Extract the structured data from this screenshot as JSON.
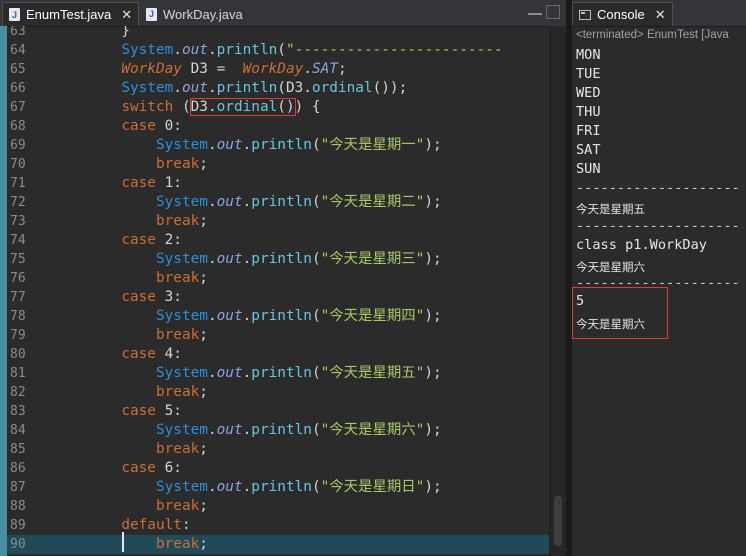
{
  "editor": {
    "tabs": [
      {
        "label": "EnumTest.java",
        "active": true
      },
      {
        "label": "WorkDay.java",
        "active": false
      }
    ],
    "lines": [
      {
        "num": "63",
        "segments": [
          {
            "t": "        }",
            "c": "plain"
          }
        ]
      },
      {
        "num": "64",
        "segments": [
          {
            "t": "        ",
            "c": "plain"
          },
          {
            "t": "System",
            "c": "cls"
          },
          {
            "t": ".",
            "c": "plain"
          },
          {
            "t": "out",
            "c": "fld"
          },
          {
            "t": ".",
            "c": "plain"
          },
          {
            "t": "println",
            "c": "mth"
          },
          {
            "t": "(",
            "c": "plain"
          },
          {
            "t": "\"------------------------",
            "c": "str"
          }
        ]
      },
      {
        "num": "65",
        "segments": [
          {
            "t": "        ",
            "c": "plain"
          },
          {
            "t": "WorkDay",
            "c": "kw ital"
          },
          {
            "t": " D3 =  ",
            "c": "plain"
          },
          {
            "t": "WorkDay",
            "c": "kw ital"
          },
          {
            "t": ".",
            "c": "plain"
          },
          {
            "t": "SAT",
            "c": "fld"
          },
          {
            "t": ";",
            "c": "plain"
          }
        ]
      },
      {
        "num": "66",
        "segments": [
          {
            "t": "        ",
            "c": "plain"
          },
          {
            "t": "System",
            "c": "cls"
          },
          {
            "t": ".",
            "c": "plain"
          },
          {
            "t": "out",
            "c": "fld"
          },
          {
            "t": ".",
            "c": "plain"
          },
          {
            "t": "println",
            "c": "mth"
          },
          {
            "t": "(D3.",
            "c": "plain"
          },
          {
            "t": "ordinal",
            "c": "mth"
          },
          {
            "t": "());",
            "c": "plain"
          }
        ]
      },
      {
        "num": "67",
        "segments": [
          {
            "t": "        ",
            "c": "plain"
          },
          {
            "t": "switch",
            "c": "kw"
          },
          {
            "t": " (",
            "c": "plain"
          },
          {
            "t": "D3.",
            "c": "plain",
            "box": "start"
          },
          {
            "t": "ordinal",
            "c": "mth"
          },
          {
            "t": "()",
            "c": "plain",
            "box": "end"
          },
          {
            "t": ") {",
            "c": "plain"
          }
        ]
      },
      {
        "num": "68",
        "segments": [
          {
            "t": "        ",
            "c": "plain"
          },
          {
            "t": "case",
            "c": "kw"
          },
          {
            "t": " 0:",
            "c": "plain"
          }
        ]
      },
      {
        "num": "69",
        "segments": [
          {
            "t": "            ",
            "c": "plain"
          },
          {
            "t": "System",
            "c": "cls"
          },
          {
            "t": ".",
            "c": "plain"
          },
          {
            "t": "out",
            "c": "fld"
          },
          {
            "t": ".",
            "c": "plain"
          },
          {
            "t": "println",
            "c": "mth"
          },
          {
            "t": "(",
            "c": "plain"
          },
          {
            "t": "\"今天是星期一\"",
            "c": "str"
          },
          {
            "t": ");",
            "c": "plain"
          }
        ]
      },
      {
        "num": "70",
        "segments": [
          {
            "t": "            ",
            "c": "plain"
          },
          {
            "t": "break",
            "c": "kw"
          },
          {
            "t": ";",
            "c": "plain"
          }
        ]
      },
      {
        "num": "71",
        "segments": [
          {
            "t": "        ",
            "c": "plain"
          },
          {
            "t": "case",
            "c": "kw"
          },
          {
            "t": " 1:",
            "c": "plain"
          }
        ]
      },
      {
        "num": "72",
        "segments": [
          {
            "t": "            ",
            "c": "plain"
          },
          {
            "t": "System",
            "c": "cls"
          },
          {
            "t": ".",
            "c": "plain"
          },
          {
            "t": "out",
            "c": "fld"
          },
          {
            "t": ".",
            "c": "plain"
          },
          {
            "t": "println",
            "c": "mth"
          },
          {
            "t": "(",
            "c": "plain"
          },
          {
            "t": "\"今天是星期二\"",
            "c": "str"
          },
          {
            "t": ");",
            "c": "plain"
          }
        ]
      },
      {
        "num": "73",
        "segments": [
          {
            "t": "            ",
            "c": "plain"
          },
          {
            "t": "break",
            "c": "kw"
          },
          {
            "t": ";",
            "c": "plain"
          }
        ]
      },
      {
        "num": "74",
        "segments": [
          {
            "t": "        ",
            "c": "plain"
          },
          {
            "t": "case",
            "c": "kw"
          },
          {
            "t": " 2:",
            "c": "plain"
          }
        ]
      },
      {
        "num": "75",
        "segments": [
          {
            "t": "            ",
            "c": "plain"
          },
          {
            "t": "System",
            "c": "cls"
          },
          {
            "t": ".",
            "c": "plain"
          },
          {
            "t": "out",
            "c": "fld"
          },
          {
            "t": ".",
            "c": "plain"
          },
          {
            "t": "println",
            "c": "mth"
          },
          {
            "t": "(",
            "c": "plain"
          },
          {
            "t": "\"今天是星期三\"",
            "c": "str"
          },
          {
            "t": ");",
            "c": "plain"
          }
        ]
      },
      {
        "num": "76",
        "segments": [
          {
            "t": "            ",
            "c": "plain"
          },
          {
            "t": "break",
            "c": "kw"
          },
          {
            "t": ";",
            "c": "plain"
          }
        ]
      },
      {
        "num": "77",
        "segments": [
          {
            "t": "        ",
            "c": "plain"
          },
          {
            "t": "case",
            "c": "kw"
          },
          {
            "t": " 3:",
            "c": "plain"
          }
        ]
      },
      {
        "num": "78",
        "segments": [
          {
            "t": "            ",
            "c": "plain"
          },
          {
            "t": "System",
            "c": "cls"
          },
          {
            "t": ".",
            "c": "plain"
          },
          {
            "t": "out",
            "c": "fld"
          },
          {
            "t": ".",
            "c": "plain"
          },
          {
            "t": "println",
            "c": "mth"
          },
          {
            "t": "(",
            "c": "plain"
          },
          {
            "t": "\"今天是星期四\"",
            "c": "str"
          },
          {
            "t": ");",
            "c": "plain"
          }
        ]
      },
      {
        "num": "79",
        "segments": [
          {
            "t": "            ",
            "c": "plain"
          },
          {
            "t": "break",
            "c": "kw"
          },
          {
            "t": ";",
            "c": "plain"
          }
        ]
      },
      {
        "num": "80",
        "segments": [
          {
            "t": "        ",
            "c": "plain"
          },
          {
            "t": "case",
            "c": "kw"
          },
          {
            "t": " 4:",
            "c": "plain"
          }
        ]
      },
      {
        "num": "81",
        "segments": [
          {
            "t": "            ",
            "c": "plain"
          },
          {
            "t": "System",
            "c": "cls"
          },
          {
            "t": ".",
            "c": "plain"
          },
          {
            "t": "out",
            "c": "fld"
          },
          {
            "t": ".",
            "c": "plain"
          },
          {
            "t": "println",
            "c": "mth"
          },
          {
            "t": "(",
            "c": "plain"
          },
          {
            "t": "\"今天是星期五\"",
            "c": "str"
          },
          {
            "t": ");",
            "c": "plain"
          }
        ]
      },
      {
        "num": "82",
        "segments": [
          {
            "t": "            ",
            "c": "plain"
          },
          {
            "t": "break",
            "c": "kw"
          },
          {
            "t": ";",
            "c": "plain"
          }
        ]
      },
      {
        "num": "83",
        "segments": [
          {
            "t": "        ",
            "c": "plain"
          },
          {
            "t": "case",
            "c": "kw"
          },
          {
            "t": " 5:",
            "c": "plain"
          }
        ]
      },
      {
        "num": "84",
        "segments": [
          {
            "t": "            ",
            "c": "plain"
          },
          {
            "t": "System",
            "c": "cls"
          },
          {
            "t": ".",
            "c": "plain"
          },
          {
            "t": "out",
            "c": "fld"
          },
          {
            "t": ".",
            "c": "plain"
          },
          {
            "t": "println",
            "c": "mth"
          },
          {
            "t": "(",
            "c": "plain"
          },
          {
            "t": "\"今天是星期六\"",
            "c": "str"
          },
          {
            "t": ");",
            "c": "plain"
          }
        ]
      },
      {
        "num": "85",
        "segments": [
          {
            "t": "            ",
            "c": "plain"
          },
          {
            "t": "break",
            "c": "kw"
          },
          {
            "t": ";",
            "c": "plain"
          }
        ]
      },
      {
        "num": "86",
        "segments": [
          {
            "t": "        ",
            "c": "plain"
          },
          {
            "t": "case",
            "c": "kw"
          },
          {
            "t": " 6:",
            "c": "plain"
          }
        ]
      },
      {
        "num": "87",
        "segments": [
          {
            "t": "            ",
            "c": "plain"
          },
          {
            "t": "System",
            "c": "cls"
          },
          {
            "t": ".",
            "c": "plain"
          },
          {
            "t": "out",
            "c": "fld"
          },
          {
            "t": ".",
            "c": "plain"
          },
          {
            "t": "println",
            "c": "mth"
          },
          {
            "t": "(",
            "c": "plain"
          },
          {
            "t": "\"今天是星期日\"",
            "c": "str"
          },
          {
            "t": ");",
            "c": "plain"
          }
        ]
      },
      {
        "num": "88",
        "segments": [
          {
            "t": "            ",
            "c": "plain"
          },
          {
            "t": "break",
            "c": "kw"
          },
          {
            "t": ";",
            "c": "plain"
          }
        ]
      },
      {
        "num": "89",
        "segments": [
          {
            "t": "        ",
            "c": "plain"
          },
          {
            "t": "default",
            "c": "kw"
          },
          {
            "t": ":",
            "c": "plain"
          }
        ]
      },
      {
        "num": "90",
        "current": true,
        "segments": [
          {
            "t": "            ",
            "c": "plain"
          },
          {
            "t": "break",
            "c": "kw"
          },
          {
            "t": ";",
            "c": "plain"
          }
        ]
      }
    ]
  },
  "console": {
    "tab_label": "Console",
    "status": "<terminated> EnumTest [Java",
    "output": [
      {
        "text": "MON",
        "kind": "mono"
      },
      {
        "text": "TUE",
        "kind": "mono"
      },
      {
        "text": "WED",
        "kind": "mono"
      },
      {
        "text": "THU",
        "kind": "mono"
      },
      {
        "text": "FRI",
        "kind": "mono"
      },
      {
        "text": "SAT",
        "kind": "mono"
      },
      {
        "text": "SUN",
        "kind": "mono"
      },
      {
        "text": "--------------------",
        "kind": "dash"
      },
      {
        "text": "今天是星期五",
        "kind": "cjk"
      },
      {
        "text": "--------------------",
        "kind": "dash"
      },
      {
        "text": "class p1.WorkDay",
        "kind": "mono"
      },
      {
        "text": "今天是星期六",
        "kind": "cjk"
      },
      {
        "text": "--------------------",
        "kind": "dash"
      },
      {
        "text": "5",
        "kind": "mono"
      },
      {
        "text": "今天是星期六",
        "kind": "cjk"
      }
    ]
  },
  "colors": {
    "keyword": "#cc6e36",
    "class": "#2f8fd8",
    "string": "#a9c767",
    "highlight_box": "#e03a3a",
    "current_line": "#204a57"
  }
}
